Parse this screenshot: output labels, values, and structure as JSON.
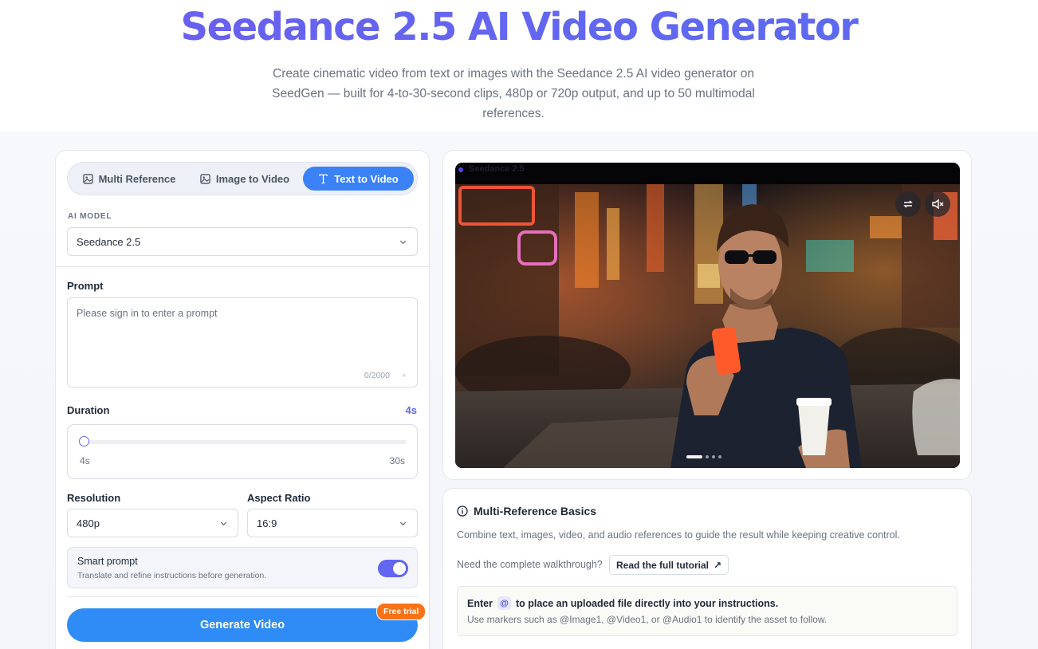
{
  "hero": {
    "title": "Seedance 2.5 AI Video Generator",
    "subtitle": "Create cinematic video from text or images with the Seedance 2.5 AI video generator on SeedGen — built for 4-to-30-second clips, 480p or 720p output, and up to 50 multimodal references."
  },
  "tabs": [
    {
      "label": "Multi Reference",
      "icon": "image-icon",
      "active": false
    },
    {
      "label": "Image to Video",
      "icon": "image-icon",
      "active": false
    },
    {
      "label": "Text to Video",
      "icon": "text-icon",
      "active": true
    }
  ],
  "model": {
    "label": "AI MODEL",
    "value": "Seedance 2.5"
  },
  "prompt": {
    "label": "Prompt",
    "placeholder": "Please sign in to enter a prompt",
    "counter": "0/2000",
    "clear": "×"
  },
  "duration": {
    "label": "Duration",
    "value": "4s",
    "min_label": "4s",
    "max_label": "30s",
    "min": 4,
    "max": 30,
    "current": 4
  },
  "resolution": {
    "label": "Resolution",
    "value": "480p"
  },
  "aspect": {
    "label": "Aspect Ratio",
    "value": "16:9"
  },
  "smart_prompt": {
    "title": "Smart prompt",
    "desc": "Translate and refine instructions before generation.",
    "enabled": true
  },
  "generate": {
    "label": "Generate Video",
    "badge": "Free trial"
  },
  "video": {
    "model_label": "Seedance 2.5",
    "slides": 4,
    "current_slide": 1
  },
  "info": {
    "title": "Multi-Reference Basics",
    "desc": "Combine text, images, video, and audio references to guide the result while keeping creative control.",
    "walkthrough": "Need the complete walkthrough?",
    "tutorial_btn": "Read the full tutorial",
    "tutorial_arrow": "↗",
    "tip_enter": "Enter",
    "tip_at": "@",
    "tip_rest": "to place an uploaded file directly into your instructions.",
    "tip_line2": "Use markers such as @Image1, @Video1, or @Audio1 to identify the asset to follow."
  },
  "colors": {
    "accent": "#6366f1",
    "primary": "#2f8cf6",
    "badge": "#f97316"
  }
}
